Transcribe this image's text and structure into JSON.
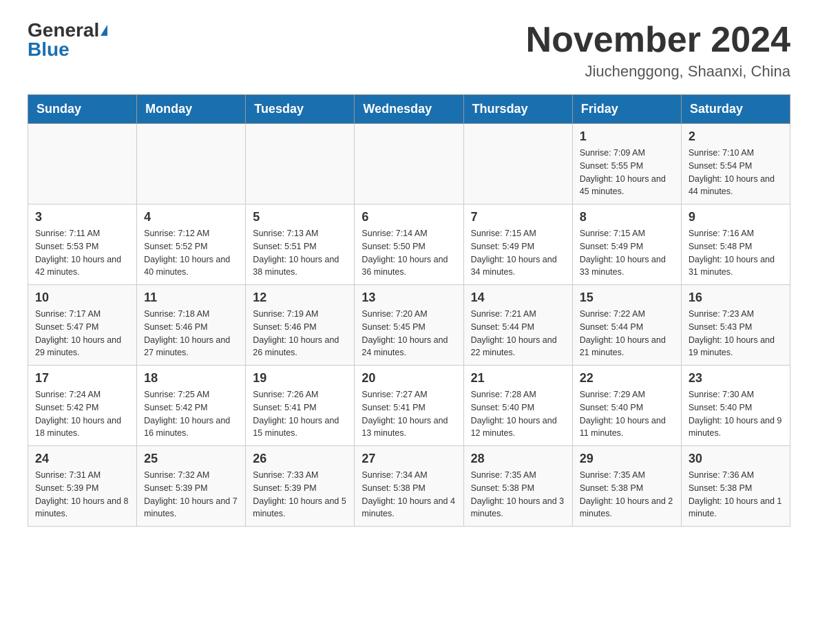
{
  "logo": {
    "general": "General",
    "blue": "Blue"
  },
  "header": {
    "month_year": "November 2024",
    "location": "Jiuchenggong, Shaanxi, China"
  },
  "days_of_week": [
    "Sunday",
    "Monday",
    "Tuesday",
    "Wednesday",
    "Thursday",
    "Friday",
    "Saturday"
  ],
  "weeks": [
    [
      {
        "day": "",
        "sunrise": "",
        "sunset": "",
        "daylight": ""
      },
      {
        "day": "",
        "sunrise": "",
        "sunset": "",
        "daylight": ""
      },
      {
        "day": "",
        "sunrise": "",
        "sunset": "",
        "daylight": ""
      },
      {
        "day": "",
        "sunrise": "",
        "sunset": "",
        "daylight": ""
      },
      {
        "day": "",
        "sunrise": "",
        "sunset": "",
        "daylight": ""
      },
      {
        "day": "1",
        "sunrise": "Sunrise: 7:09 AM",
        "sunset": "Sunset: 5:55 PM",
        "daylight": "Daylight: 10 hours and 45 minutes."
      },
      {
        "day": "2",
        "sunrise": "Sunrise: 7:10 AM",
        "sunset": "Sunset: 5:54 PM",
        "daylight": "Daylight: 10 hours and 44 minutes."
      }
    ],
    [
      {
        "day": "3",
        "sunrise": "Sunrise: 7:11 AM",
        "sunset": "Sunset: 5:53 PM",
        "daylight": "Daylight: 10 hours and 42 minutes."
      },
      {
        "day": "4",
        "sunrise": "Sunrise: 7:12 AM",
        "sunset": "Sunset: 5:52 PM",
        "daylight": "Daylight: 10 hours and 40 minutes."
      },
      {
        "day": "5",
        "sunrise": "Sunrise: 7:13 AM",
        "sunset": "Sunset: 5:51 PM",
        "daylight": "Daylight: 10 hours and 38 minutes."
      },
      {
        "day": "6",
        "sunrise": "Sunrise: 7:14 AM",
        "sunset": "Sunset: 5:50 PM",
        "daylight": "Daylight: 10 hours and 36 minutes."
      },
      {
        "day": "7",
        "sunrise": "Sunrise: 7:15 AM",
        "sunset": "Sunset: 5:49 PM",
        "daylight": "Daylight: 10 hours and 34 minutes."
      },
      {
        "day": "8",
        "sunrise": "Sunrise: 7:15 AM",
        "sunset": "Sunset: 5:49 PM",
        "daylight": "Daylight: 10 hours and 33 minutes."
      },
      {
        "day": "9",
        "sunrise": "Sunrise: 7:16 AM",
        "sunset": "Sunset: 5:48 PM",
        "daylight": "Daylight: 10 hours and 31 minutes."
      }
    ],
    [
      {
        "day": "10",
        "sunrise": "Sunrise: 7:17 AM",
        "sunset": "Sunset: 5:47 PM",
        "daylight": "Daylight: 10 hours and 29 minutes."
      },
      {
        "day": "11",
        "sunrise": "Sunrise: 7:18 AM",
        "sunset": "Sunset: 5:46 PM",
        "daylight": "Daylight: 10 hours and 27 minutes."
      },
      {
        "day": "12",
        "sunrise": "Sunrise: 7:19 AM",
        "sunset": "Sunset: 5:46 PM",
        "daylight": "Daylight: 10 hours and 26 minutes."
      },
      {
        "day": "13",
        "sunrise": "Sunrise: 7:20 AM",
        "sunset": "Sunset: 5:45 PM",
        "daylight": "Daylight: 10 hours and 24 minutes."
      },
      {
        "day": "14",
        "sunrise": "Sunrise: 7:21 AM",
        "sunset": "Sunset: 5:44 PM",
        "daylight": "Daylight: 10 hours and 22 minutes."
      },
      {
        "day": "15",
        "sunrise": "Sunrise: 7:22 AM",
        "sunset": "Sunset: 5:44 PM",
        "daylight": "Daylight: 10 hours and 21 minutes."
      },
      {
        "day": "16",
        "sunrise": "Sunrise: 7:23 AM",
        "sunset": "Sunset: 5:43 PM",
        "daylight": "Daylight: 10 hours and 19 minutes."
      }
    ],
    [
      {
        "day": "17",
        "sunrise": "Sunrise: 7:24 AM",
        "sunset": "Sunset: 5:42 PM",
        "daylight": "Daylight: 10 hours and 18 minutes."
      },
      {
        "day": "18",
        "sunrise": "Sunrise: 7:25 AM",
        "sunset": "Sunset: 5:42 PM",
        "daylight": "Daylight: 10 hours and 16 minutes."
      },
      {
        "day": "19",
        "sunrise": "Sunrise: 7:26 AM",
        "sunset": "Sunset: 5:41 PM",
        "daylight": "Daylight: 10 hours and 15 minutes."
      },
      {
        "day": "20",
        "sunrise": "Sunrise: 7:27 AM",
        "sunset": "Sunset: 5:41 PM",
        "daylight": "Daylight: 10 hours and 13 minutes."
      },
      {
        "day": "21",
        "sunrise": "Sunrise: 7:28 AM",
        "sunset": "Sunset: 5:40 PM",
        "daylight": "Daylight: 10 hours and 12 minutes."
      },
      {
        "day": "22",
        "sunrise": "Sunrise: 7:29 AM",
        "sunset": "Sunset: 5:40 PM",
        "daylight": "Daylight: 10 hours and 11 minutes."
      },
      {
        "day": "23",
        "sunrise": "Sunrise: 7:30 AM",
        "sunset": "Sunset: 5:40 PM",
        "daylight": "Daylight: 10 hours and 9 minutes."
      }
    ],
    [
      {
        "day": "24",
        "sunrise": "Sunrise: 7:31 AM",
        "sunset": "Sunset: 5:39 PM",
        "daylight": "Daylight: 10 hours and 8 minutes."
      },
      {
        "day": "25",
        "sunrise": "Sunrise: 7:32 AM",
        "sunset": "Sunset: 5:39 PM",
        "daylight": "Daylight: 10 hours and 7 minutes."
      },
      {
        "day": "26",
        "sunrise": "Sunrise: 7:33 AM",
        "sunset": "Sunset: 5:39 PM",
        "daylight": "Daylight: 10 hours and 5 minutes."
      },
      {
        "day": "27",
        "sunrise": "Sunrise: 7:34 AM",
        "sunset": "Sunset: 5:38 PM",
        "daylight": "Daylight: 10 hours and 4 minutes."
      },
      {
        "day": "28",
        "sunrise": "Sunrise: 7:35 AM",
        "sunset": "Sunset: 5:38 PM",
        "daylight": "Daylight: 10 hours and 3 minutes."
      },
      {
        "day": "29",
        "sunrise": "Sunrise: 7:35 AM",
        "sunset": "Sunset: 5:38 PM",
        "daylight": "Daylight: 10 hours and 2 minutes."
      },
      {
        "day": "30",
        "sunrise": "Sunrise: 7:36 AM",
        "sunset": "Sunset: 5:38 PM",
        "daylight": "Daylight: 10 hours and 1 minute."
      }
    ]
  ]
}
